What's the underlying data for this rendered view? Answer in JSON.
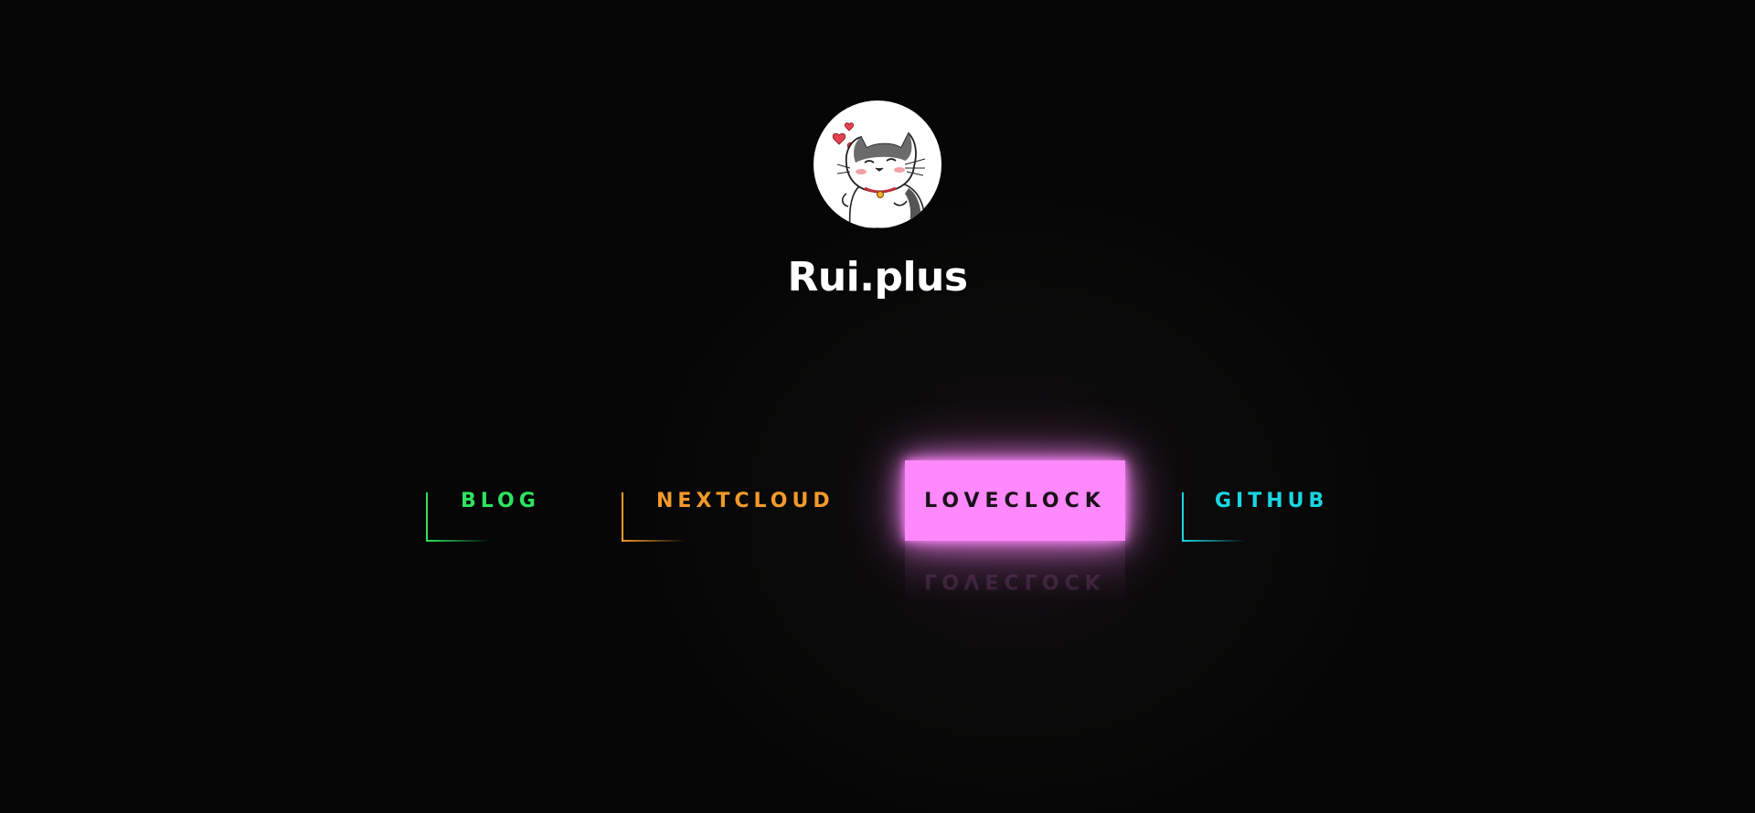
{
  "site": {
    "title": "Rui.plus",
    "avatar_icon": "cat-avatar-icon"
  },
  "nav": {
    "links": [
      {
        "label": "BLOG",
        "color": "#2fe35f"
      },
      {
        "label": "NEXTCLOUD",
        "color": "#f39a2a"
      },
      {
        "label": "LOVECLOCK",
        "color": "#ff88fc",
        "active": true
      },
      {
        "label": "GITHUB",
        "color": "#1ad6e3"
      }
    ]
  },
  "colors": {
    "background": "#040604",
    "title": "#ffffff",
    "active_text": "#1a121a"
  }
}
